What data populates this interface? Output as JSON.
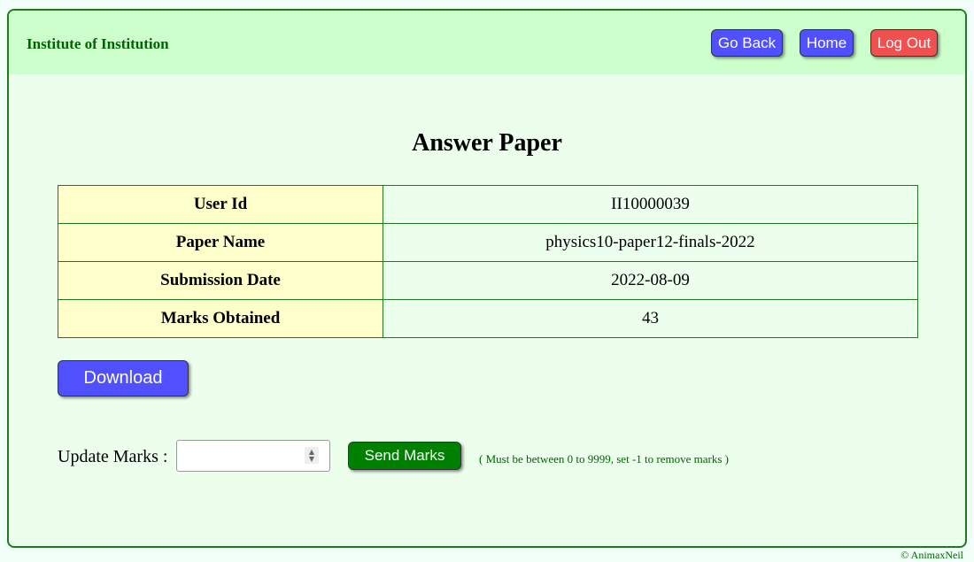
{
  "header": {
    "brand": "Institute of Institution",
    "go_back_label": "Go Back",
    "home_label": "Home",
    "logout_label": "Log Out"
  },
  "page_title": "Answer Paper",
  "details": [
    {
      "label": "User Id",
      "value": "II10000039"
    },
    {
      "label": "Paper Name",
      "value": "physics10-paper12-finals-2022"
    },
    {
      "label": "Submission Date",
      "value": "2022-08-09"
    },
    {
      "label": "Marks Obtained",
      "value": "43"
    }
  ],
  "download_label": "Download",
  "update": {
    "label": "Update Marks :",
    "input_value": "",
    "send_label": "Send Marks",
    "hint": "( Must be between 0 to 9999, set -1 to remove marks )"
  },
  "footer": {
    "copyright": "© AnimaxNeil"
  },
  "colors": {
    "header_bg": "#ccffcc",
    "primary_button": "#5050ff",
    "danger_button": "#f05050",
    "success_button": "#008000",
    "brand_text": "#006400",
    "label_cell_bg": "#ffffcc"
  },
  "icons": {
    "number_spinner": "spinner-arrows-icon"
  }
}
